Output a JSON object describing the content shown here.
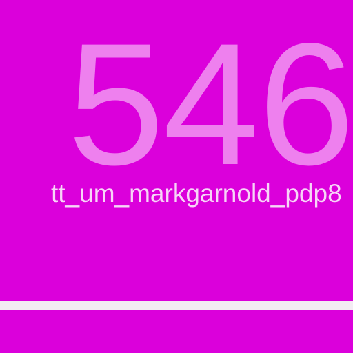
{
  "screen": {
    "count_value": "546",
    "label_text": "tt_um_markgarnold_pdp8"
  },
  "colors": {
    "background": "#db00db",
    "number": "#ee80ee",
    "label": "#f7d5f7",
    "divider": "#f3ecf3"
  }
}
